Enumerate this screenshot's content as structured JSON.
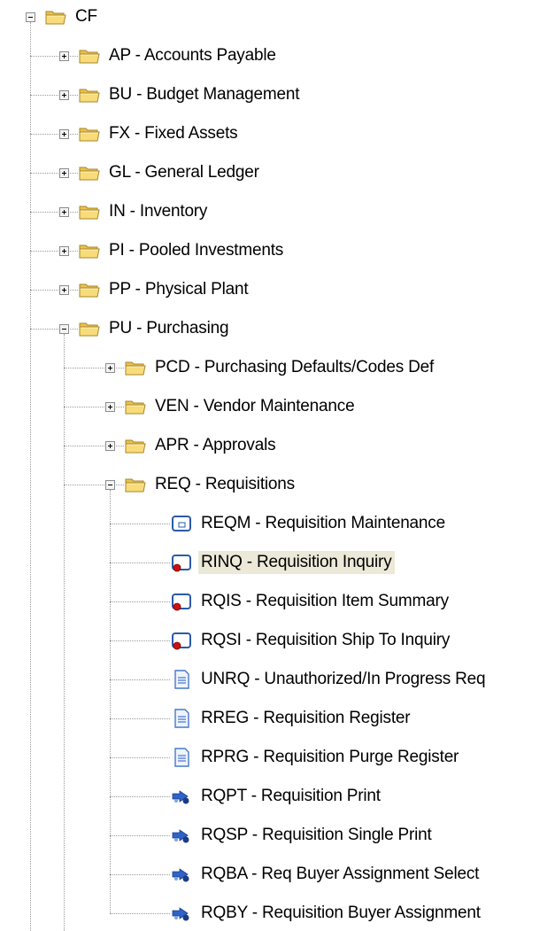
{
  "root": {
    "label": "CF",
    "expanded": true
  },
  "modules": [
    {
      "label": "AP - Accounts Payable",
      "expanded": false
    },
    {
      "label": "BU - Budget Management",
      "expanded": false
    },
    {
      "label": "FX - Fixed Assets",
      "expanded": false
    },
    {
      "label": "GL - General Ledger",
      "expanded": false
    },
    {
      "label": "IN - Inventory",
      "expanded": false
    },
    {
      "label": "PI - Pooled Investments",
      "expanded": false
    },
    {
      "label": "PP - Physical Plant",
      "expanded": false
    },
    {
      "label": "PU - Purchasing",
      "expanded": true
    }
  ],
  "purchasing_children": [
    {
      "label": "PCD - Purchasing Defaults/Codes Def",
      "expanded": false
    },
    {
      "label": "VEN - Vendor Maintenance",
      "expanded": false
    },
    {
      "label": "APR - Approvals",
      "expanded": false
    },
    {
      "label": "REQ - Requisitions",
      "expanded": true
    }
  ],
  "requisition_items": [
    {
      "label": "REQM - Requisition Maintenance",
      "icon": "form-icon",
      "selected": false
    },
    {
      "label": "RINQ - Requisition Inquiry",
      "icon": "inquiry-form-icon",
      "selected": true
    },
    {
      "label": "RQIS - Requisition Item Summary",
      "icon": "inquiry-form-icon",
      "selected": false
    },
    {
      "label": "RQSI - Requisition Ship To Inquiry",
      "icon": "inquiry-form-icon",
      "selected": false
    },
    {
      "label": "UNRQ - Unauthorized/In Progress Req",
      "icon": "report-icon",
      "selected": false
    },
    {
      "label": "RREG - Requisition Register",
      "icon": "report-icon",
      "selected": false
    },
    {
      "label": "RPRG - Requisition Purge Register",
      "icon": "report-icon",
      "selected": false
    },
    {
      "label": "RQPT - Requisition Print",
      "icon": "process-icon",
      "selected": false
    },
    {
      "label": "RQSP - Requisition Single Print",
      "icon": "process-icon",
      "selected": false
    },
    {
      "label": "RQBA - Req Buyer Assignment Select",
      "icon": "process-icon",
      "selected": false
    },
    {
      "label": "RQBY - Requisition Buyer Assignment",
      "icon": "process-icon",
      "selected": false
    }
  ],
  "colors": {
    "selection": "#ece9d8",
    "folder": "#f5d56a",
    "form_frame": "#2b5aa8",
    "inquiry_badge": "#cc1111",
    "report": "#4a78c8"
  }
}
